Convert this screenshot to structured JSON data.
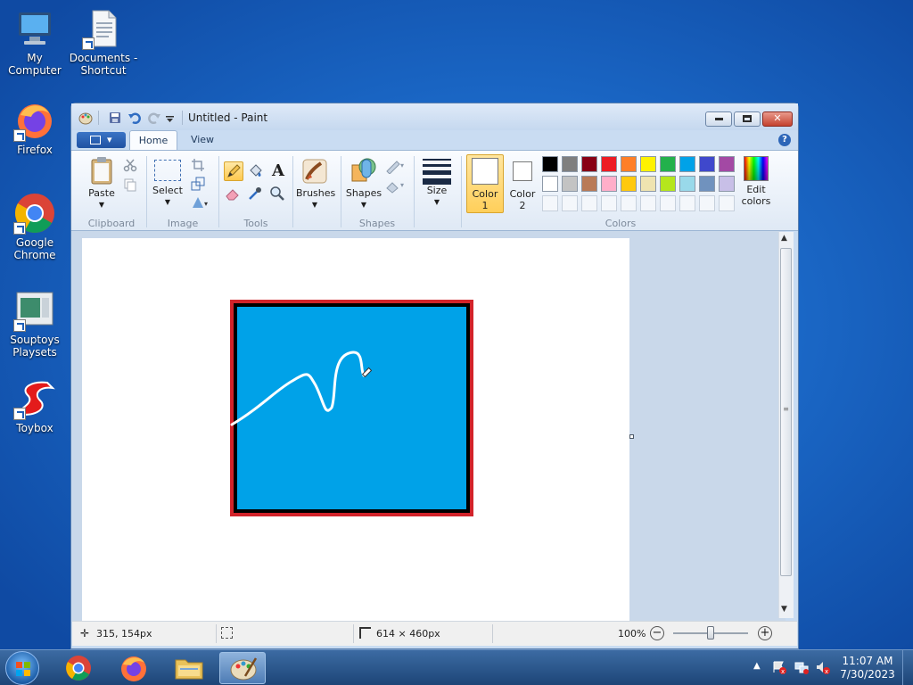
{
  "desktop": {
    "icons": [
      {
        "label": "My Computer",
        "icon": "computer-icon"
      },
      {
        "label": "Documents - Shortcut",
        "icon": "documents-icon"
      },
      {
        "label": "Firefox",
        "icon": "firefox-icon"
      },
      {
        "label": "Google Chrome",
        "icon": "chrome-icon"
      },
      {
        "label": "Souptoys Playsets",
        "icon": "souptoys-icon"
      },
      {
        "label": "Toybox",
        "icon": "toybox-icon"
      }
    ]
  },
  "window": {
    "title": "Untitled - Paint",
    "tabs": [
      "Home",
      "View"
    ],
    "active_tab": "Home"
  },
  "ribbon": {
    "clipboard": {
      "paste": "Paste",
      "group": "Clipboard"
    },
    "image": {
      "select": "Select",
      "group": "Image"
    },
    "tools": {
      "text_tool": "A",
      "group": "Tools"
    },
    "brushes": {
      "label": "Brushes"
    },
    "shapes": {
      "label": "Shapes",
      "group": "Shapes"
    },
    "size": {
      "label": "Size"
    },
    "color1": {
      "line1": "Color",
      "line2": "1"
    },
    "color2": {
      "line1": "Color",
      "line2": "2"
    },
    "edit_colors": {
      "line1": "Edit",
      "line2": "colors"
    },
    "colors_group": "Colors"
  },
  "palette": {
    "row1": [
      "#000000",
      "#7f7f7f",
      "#880015",
      "#ed1c24",
      "#ff7f27",
      "#fff200",
      "#22b14c",
      "#00a2e8",
      "#3f48cc",
      "#a349a4"
    ],
    "row2": [
      "#ffffff",
      "#c3c3c3",
      "#b97a57",
      "#ffaec9",
      "#ffc90e",
      "#efe4b0",
      "#b5e61d",
      "#99d9ea",
      "#7092be",
      "#c8bfe7"
    ],
    "empty_count": 10,
    "color1": "#ffffff",
    "color2": "#ffffff"
  },
  "drawing": {
    "frame_color": "#d2232a",
    "border_color": "#000000",
    "fill_color": "#00a2e8",
    "stroke_color": "#ffffff"
  },
  "status": {
    "cursor_pos": "315, 154px",
    "image_size": "614 × 460px",
    "zoom": "100%",
    "zoom_level": 1.0
  },
  "taskbar": {
    "clock_time": "11:07 AM",
    "clock_date": "7/30/2023"
  }
}
